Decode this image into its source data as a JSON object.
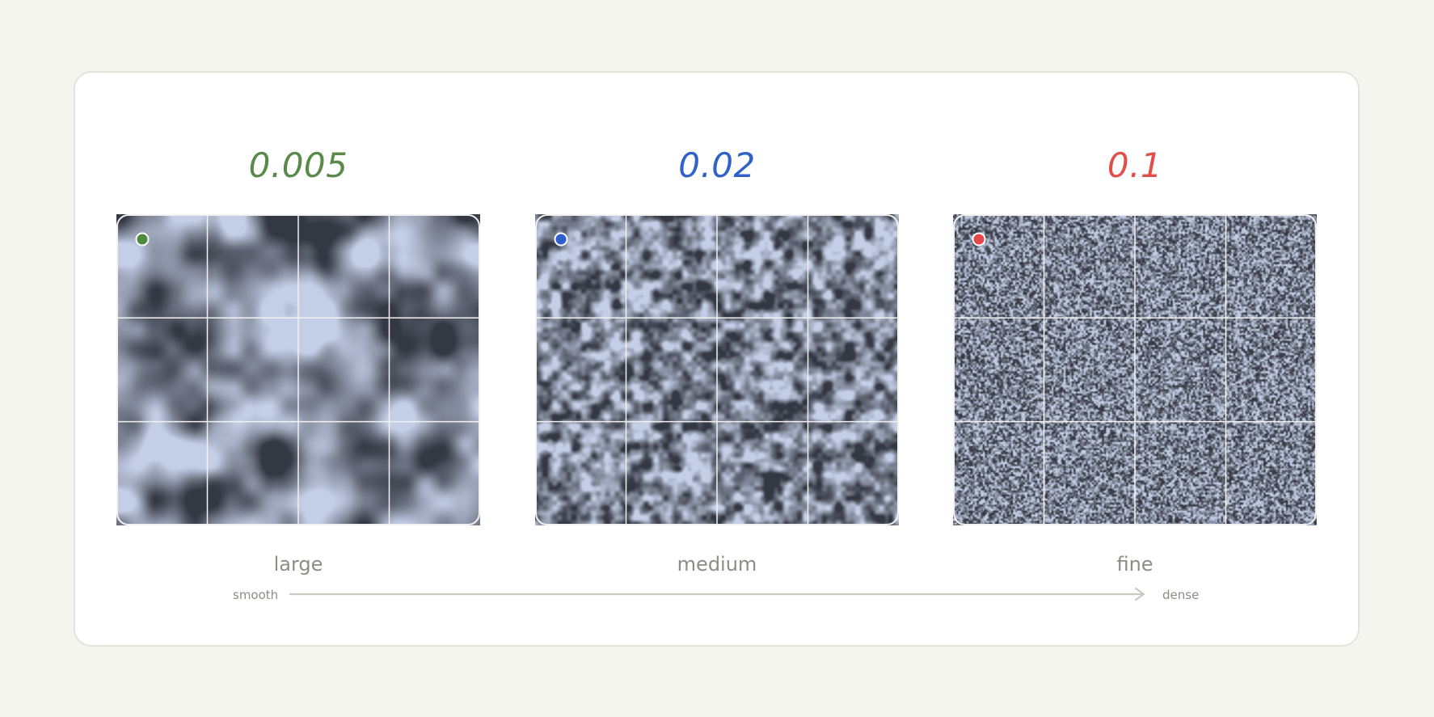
{
  "panels": [
    {
      "value": "0.005",
      "label": "large",
      "color": "#5a8a4a",
      "marker_color": "#4d8b3f",
      "noise_frequency": 0.005
    },
    {
      "value": "0.02",
      "label": "medium",
      "color": "#2f62c7",
      "marker_color": "#2c5fd0",
      "noise_frequency": 0.02
    },
    {
      "value": "0.1",
      "label": "fine",
      "color": "#e0504a",
      "marker_color": "#e5484a",
      "noise_frequency": 0.1
    }
  ],
  "axis": {
    "start_label": "smooth",
    "end_label": "dense"
  }
}
